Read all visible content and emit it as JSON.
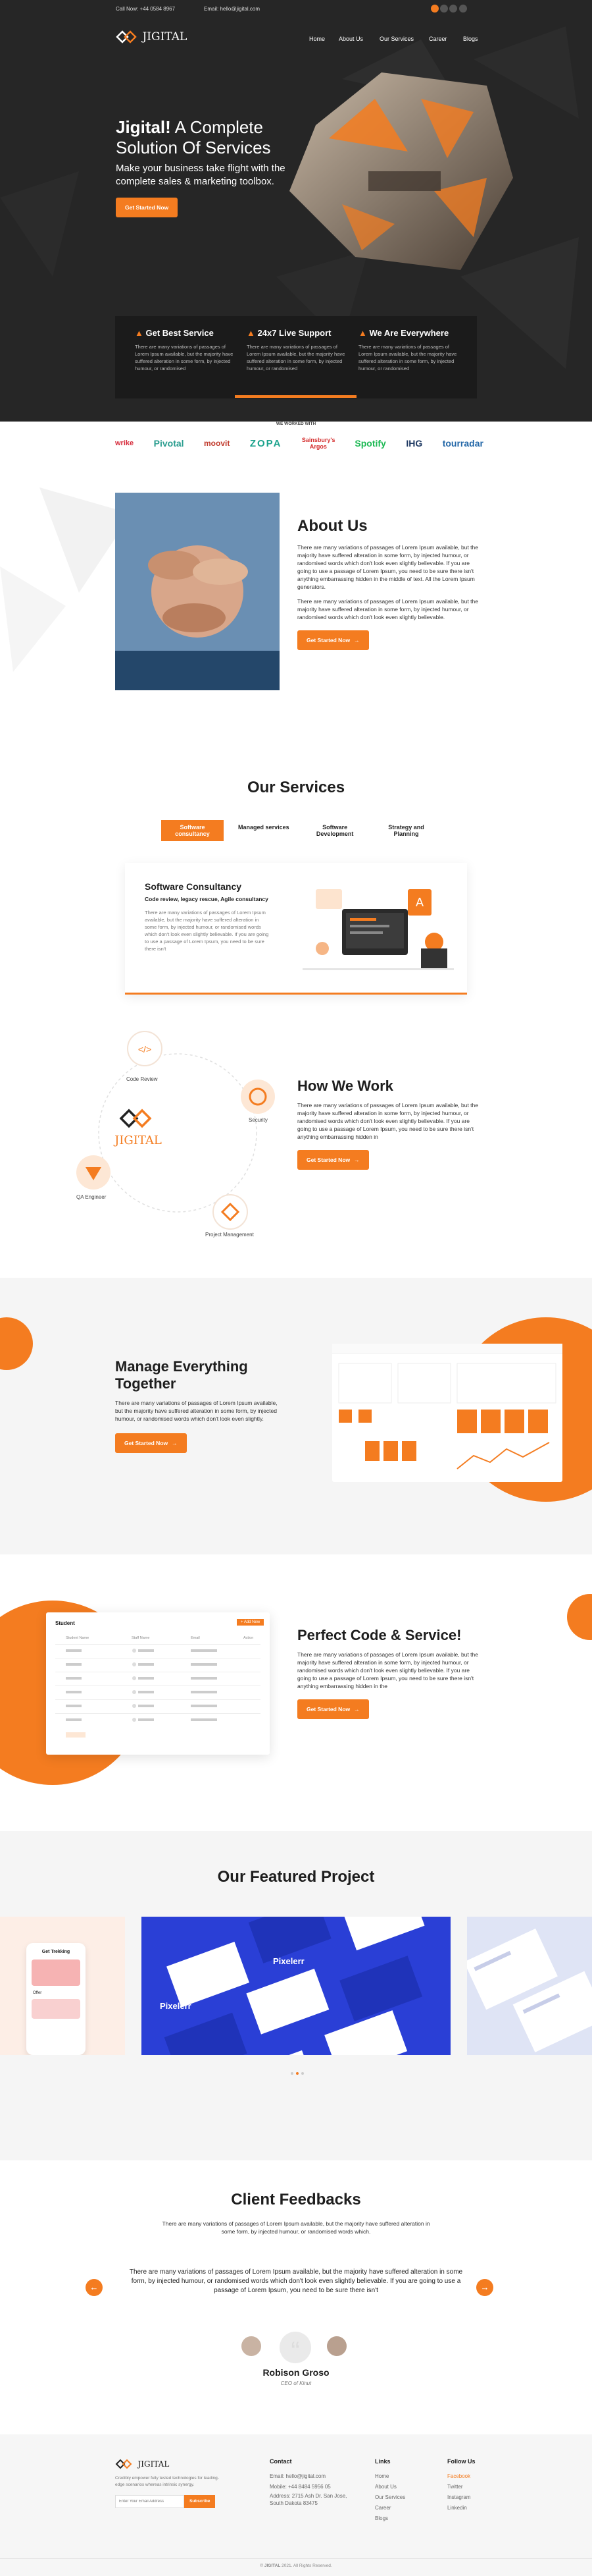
{
  "topbar": {
    "phone": "Call Now: +44 0584 8967",
    "email": "Email: hello@jigital.com"
  },
  "brand": {
    "name": "JIGITAL"
  },
  "nav": {
    "items": [
      "Home",
      "About Us",
      "Our Services",
      "Career",
      "Blogs"
    ]
  },
  "hero": {
    "title_brand": "Jigital!",
    "title_rest": " A Complete",
    "title_line2": "Solution Of Services",
    "subtitle": "Make your business take flight with the complete sales & marketing toolbox.",
    "cta": "Get Started Now"
  },
  "features": [
    {
      "title": "Get Best Service",
      "text": "There are many variations of passages of Lorem Ipsum available, but the majority have suffered alteration in some form, by injected humour, or randomised"
    },
    {
      "title": "24x7 Live Support",
      "text": "There are many variations of passages of Lorem Ipsum available, but the majority have suffered alteration in some form, by injected humour, or randomised"
    },
    {
      "title": "We Are Everywhere",
      "text": "There are many variations of passages of Lorem Ipsum available, but the majority have suffered alteration in some form, by injected humour, or randomised"
    }
  ],
  "worked_with": {
    "label": "WE WORKED WITH",
    "logos": [
      "wrike",
      "Pivotal",
      "moovit",
      "ZOPA",
      "Sainsbury's Argos",
      "Spotify",
      "IHG",
      "tourradar"
    ]
  },
  "about": {
    "title": "About Us",
    "p1": "There are many variations of passages of Lorem Ipsum available, but the majority have suffered alteration in some form, by injected humour, or randomised words which don't look even slightly believable. If you are going to use a passage of Lorem Ipsum, you need to be sure there isn't anything embarrassing hidden in the middle of text. All the Lorem Ipsum generators.",
    "p2": "There are many variations of passages of Lorem Ipsum available, but the majority have suffered alteration in some form, by injected humour, or randomised words which don't look even slightly believable.",
    "cta": "Get Started Now"
  },
  "services": {
    "title": "Our Services",
    "tabs": [
      "Software consultancy",
      "Managed services",
      "Software Development",
      "Strategy and Planning"
    ],
    "card_title": "Software Consultancy",
    "card_subtitle": "Code review, legacy rescue, Agile consultancy",
    "card_text": "There are many variations of passages of Lorem Ipsum available, but the majority have suffered alteration in some form, by injected humour, or randomised words which don't look even slightly believable. If you are going to use a passage of Lorem Ipsum, you need to be sure there isn't"
  },
  "how": {
    "title": "How We Work",
    "text": "There are many variations of passages of Lorem Ipsum available, but the majority have suffered alteration in some form, by injected humour, or randomised words which don't look even slightly believable. If you are going to use a passage of Lorem Ipsum, you need to be sure there isn't anything embarrassing hidden in",
    "cta": "Get Started Now",
    "nodes": [
      "Code Review",
      "Security",
      "QA Engineer",
      "Project Management"
    ]
  },
  "manage": {
    "title": "Manage Everything Together",
    "text": "There are many variations of passages of Lorem Ipsum available, but the majority have suffered alteration in some form, by injected humour, or randomised words which don't look even slightly.",
    "cta": "Get Started Now"
  },
  "perfect": {
    "title": "Perfect Code & Service!",
    "text": "There are many variations of passages of Lorem Ipsum available, but the majority have suffered alteration in some form, by injected humour, or randomised words which don't look even slightly believable. If you are going to use a passage of Lorem Ipsum, you need to be sure there isn't anything embarrassing hidden in the",
    "cta": "Get Started Now",
    "mock_title": "Student",
    "mock_button": "+ Add New",
    "mock_cols": [
      "Student Name",
      "Staff Name",
      "Email",
      "Action"
    ]
  },
  "featured": {
    "title": "Our Featured Project",
    "brand_card": "Pixelerr",
    "app_title": "Get Trekking",
    "app_card": "Offer"
  },
  "feedback": {
    "title": "Client Feedbacks",
    "intro": "There are many variations of passages of Lorem Ipsum available, but the majority have suffered alteration in some form, by injected humour, or randomised words which.",
    "quote": "There are many variations of passages of Lorem Ipsum available, but the majority have suffered alteration in some form, by injected humour, or randomised words which don't look even slightly believable. If you are going to use a passage of Lorem Ipsum, you need to be sure there isn't",
    "name": "Robison Groso",
    "role": "CEO of Kinut"
  },
  "footer": {
    "about": "Credibly empower fully tested technologies for leading-edge scenarios whereas intrinsic synergy.",
    "email_placeholder": "Enter Your Email Address",
    "subscribe": "Subscribe",
    "contact_title": "Contact",
    "contact": [
      "Email: hello@jigital.com",
      "Mobile: +44 8484 5956 05",
      "Address: 2715 Ash Dr. San Jose, South Dakota 83475"
    ],
    "links_title": "Links",
    "links": [
      "Home",
      "About Us",
      "Our Services",
      "Career",
      "Blogs"
    ],
    "follow_title": "Follow Us",
    "follow": [
      "Facebook",
      "Twitter",
      "Instagram",
      "Linkedin"
    ],
    "copyright_brand": "JIGITAL",
    "copyright_rest": "2021. All Rights Reserved."
  },
  "colors": {
    "accent": "#f47c20",
    "dark": "#262626"
  }
}
